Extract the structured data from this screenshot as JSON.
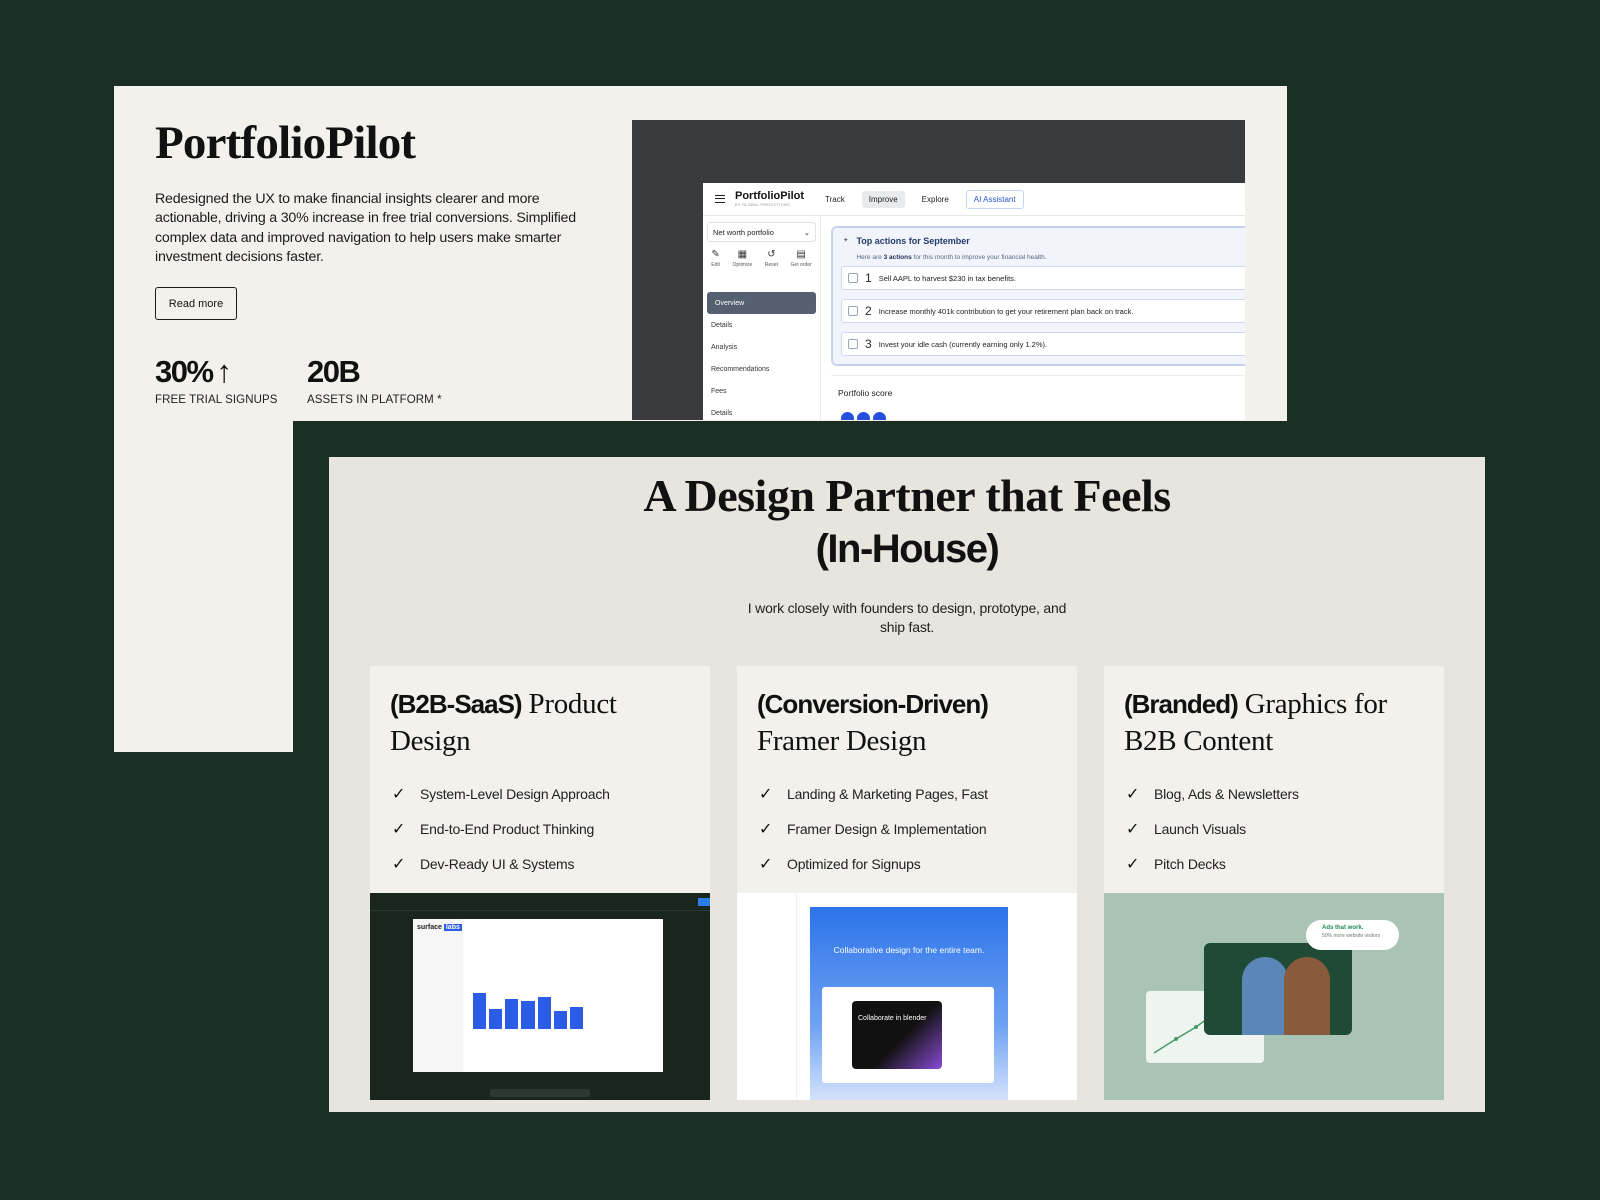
{
  "portfolio_card": {
    "title": "PortfolioPilot",
    "description": "Redesigned the UX to make financial insights clearer and more actionable, driving a 30% increase in free trial conversions. Simplified complex data and improved navigation to help users make smarter investment decisions faster.",
    "read_more_label": "Read more",
    "stats": [
      {
        "value": "30%",
        "arrow": "↑",
        "label": "FREE TRIAL SIGNUPS"
      },
      {
        "value": "20B",
        "arrow": "",
        "label": "ASSETS IN PLATFORM *"
      }
    ],
    "app_preview": {
      "brand": "PortfolioPilot",
      "brand_sub": "BY GLOBAL PREDICTIONS",
      "nav": [
        "Track",
        "Improve",
        "Explore",
        "AI Assistant"
      ],
      "active_nav": "Improve",
      "portfolio_select": "Net worth portfolio",
      "tools": [
        {
          "icon": "edit-icon",
          "glyph": "✎",
          "label": "Edit"
        },
        {
          "icon": "optimize-icon",
          "glyph": "▦",
          "label": "Optimize"
        },
        {
          "icon": "reset-icon",
          "glyph": "↺",
          "label": "Reset"
        },
        {
          "icon": "order-icon",
          "glyph": "▤",
          "label": "Get order"
        }
      ],
      "side_links": [
        "Overview",
        "Details",
        "Analysis",
        "Recommendations",
        "Fees",
        "Details"
      ],
      "actions_title": "Top actions for September",
      "actions_subtitle_pre": "Here are ",
      "actions_subtitle_bold": "3 actions",
      "actions_subtitle_post": " for this month to improve your financial health.",
      "actions": [
        {
          "num": "1",
          "text": "Sell AAPL to harvest $230 in tax benefits."
        },
        {
          "num": "2",
          "text": "Increase monthly 401k contribution to get your retirement plan back on track."
        },
        {
          "num": "3",
          "text": "Invest your idle cash (currently earning only 1.2%)."
        }
      ],
      "score_title": "Portfolio score"
    }
  },
  "design_partner": {
    "headline": "A Design Partner that Feels",
    "headline_bold": "(In-House)",
    "subtitle": "I work closely with founders to design, prototype, and ship fast.",
    "services": [
      {
        "bold": "(B2B-SaaS)",
        "serif": " Product Design",
        "items": [
          "System-Level Design Approach",
          "End-to-End Product Thinking",
          "Dev-Ready UI & Systems"
        ]
      },
      {
        "bold": "(Conversion-Driven)",
        "serif": " Framer Design",
        "items": [
          "Landing & Marketing Pages, Fast",
          "Framer Design & Implementation",
          "Optimized for Signups"
        ],
        "preview_headline": "Collaborative design for the entire team.",
        "preview_card": "Collaborate in blender"
      },
      {
        "bold": "(Branded)",
        "serif": " Graphics for B2B Content",
        "items": [
          "Blog, Ads & Newsletters",
          "Launch Visuals",
          "Pitch Decks"
        ],
        "badge_title": "Ads that work.",
        "badge_sub": "50% more website visitors"
      }
    ],
    "preview_1": {
      "logo": "surface",
      "logo_tag": "labs",
      "bar_values": [
        0.9,
        0.5,
        0.75,
        0.7,
        0.8,
        0.45,
        0.55
      ]
    }
  },
  "colors": {
    "background": "#1b2e24",
    "accent_blue": "#2a5ce6"
  }
}
